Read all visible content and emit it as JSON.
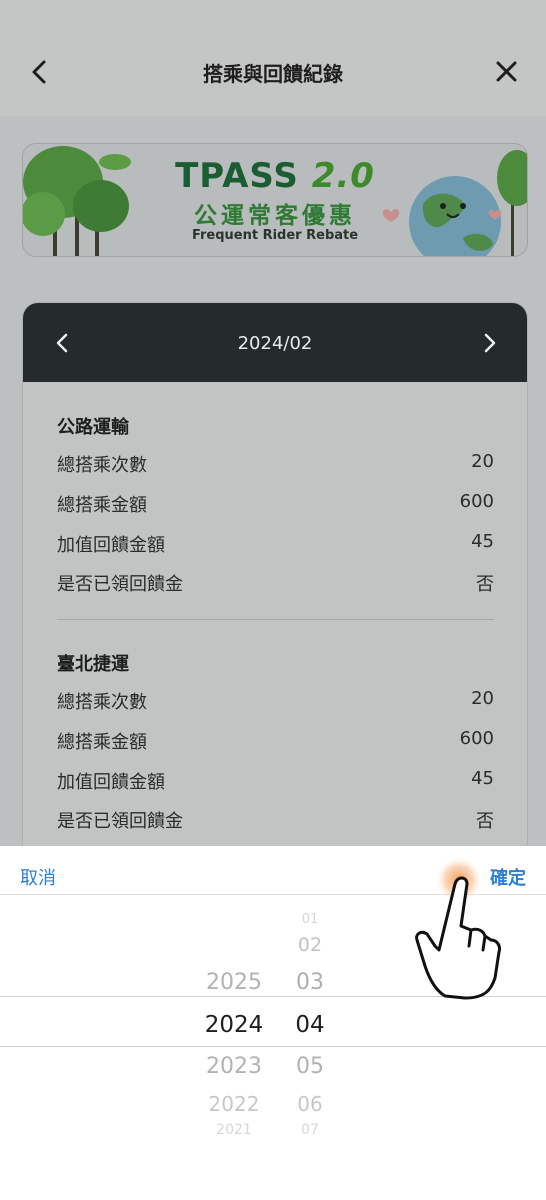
{
  "header": {
    "title": "搭乘與回饋紀錄"
  },
  "banner": {
    "tpass_word": "TPASS",
    "tpass_version": "2.0",
    "title_cn": "公運常客優惠",
    "subtitle_en": "Frequent Rider Rebate"
  },
  "record_card": {
    "month": "2024/02",
    "sections": [
      {
        "title": "公路運輸",
        "rows": [
          {
            "label": "總搭乘次數",
            "value": "20"
          },
          {
            "label": "總搭乘金額",
            "value": "600"
          },
          {
            "label": "加值回饋金額",
            "value": "45"
          },
          {
            "label": "是否已領回饋金",
            "value": "否"
          }
        ]
      },
      {
        "title": "臺北捷運",
        "rows": [
          {
            "label": "總搭乘次數",
            "value": "20"
          },
          {
            "label": "總搭乘金額",
            "value": "600"
          },
          {
            "label": "加值回饋金額",
            "value": "45"
          },
          {
            "label": "是否已領回饋金",
            "value": "否"
          }
        ]
      }
    ]
  },
  "picker": {
    "cancel_label": "取消",
    "confirm_label": "確定",
    "years": [
      "2025",
      "2024",
      "2023",
      "2022",
      "2021"
    ],
    "selected_year": "2024",
    "months": [
      "01",
      "02",
      "03",
      "04",
      "05",
      "06",
      "07"
    ],
    "selected_month": "04"
  },
  "colors": {
    "accent": "#2b7fd6",
    "card_header": "#252a2d",
    "brand_green": "#1b5c32"
  },
  "icons": [
    "back-chevron-icon",
    "close-icon",
    "chevron-left-icon",
    "chevron-right-icon",
    "tap-hand-icon"
  ]
}
